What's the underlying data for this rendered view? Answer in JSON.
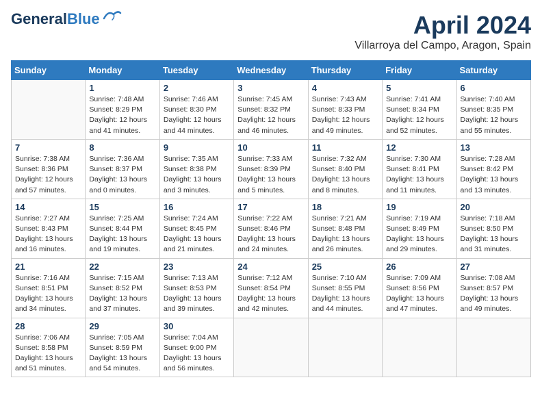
{
  "header": {
    "logo_line1": "General",
    "logo_line2": "Blue",
    "title": "April 2024",
    "subtitle": "Villarroya del Campo, Aragon, Spain"
  },
  "days_of_week": [
    "Sunday",
    "Monday",
    "Tuesday",
    "Wednesday",
    "Thursday",
    "Friday",
    "Saturday"
  ],
  "weeks": [
    [
      {
        "num": "",
        "info": ""
      },
      {
        "num": "1",
        "info": "Sunrise: 7:48 AM\nSunset: 8:29 PM\nDaylight: 12 hours\nand 41 minutes."
      },
      {
        "num": "2",
        "info": "Sunrise: 7:46 AM\nSunset: 8:30 PM\nDaylight: 12 hours\nand 44 minutes."
      },
      {
        "num": "3",
        "info": "Sunrise: 7:45 AM\nSunset: 8:32 PM\nDaylight: 12 hours\nand 46 minutes."
      },
      {
        "num": "4",
        "info": "Sunrise: 7:43 AM\nSunset: 8:33 PM\nDaylight: 12 hours\nand 49 minutes."
      },
      {
        "num": "5",
        "info": "Sunrise: 7:41 AM\nSunset: 8:34 PM\nDaylight: 12 hours\nand 52 minutes."
      },
      {
        "num": "6",
        "info": "Sunrise: 7:40 AM\nSunset: 8:35 PM\nDaylight: 12 hours\nand 55 minutes."
      }
    ],
    [
      {
        "num": "7",
        "info": "Sunrise: 7:38 AM\nSunset: 8:36 PM\nDaylight: 12 hours\nand 57 minutes."
      },
      {
        "num": "8",
        "info": "Sunrise: 7:36 AM\nSunset: 8:37 PM\nDaylight: 13 hours\nand 0 minutes."
      },
      {
        "num": "9",
        "info": "Sunrise: 7:35 AM\nSunset: 8:38 PM\nDaylight: 13 hours\nand 3 minutes."
      },
      {
        "num": "10",
        "info": "Sunrise: 7:33 AM\nSunset: 8:39 PM\nDaylight: 13 hours\nand 5 minutes."
      },
      {
        "num": "11",
        "info": "Sunrise: 7:32 AM\nSunset: 8:40 PM\nDaylight: 13 hours\nand 8 minutes."
      },
      {
        "num": "12",
        "info": "Sunrise: 7:30 AM\nSunset: 8:41 PM\nDaylight: 13 hours\nand 11 minutes."
      },
      {
        "num": "13",
        "info": "Sunrise: 7:28 AM\nSunset: 8:42 PM\nDaylight: 13 hours\nand 13 minutes."
      }
    ],
    [
      {
        "num": "14",
        "info": "Sunrise: 7:27 AM\nSunset: 8:43 PM\nDaylight: 13 hours\nand 16 minutes."
      },
      {
        "num": "15",
        "info": "Sunrise: 7:25 AM\nSunset: 8:44 PM\nDaylight: 13 hours\nand 19 minutes."
      },
      {
        "num": "16",
        "info": "Sunrise: 7:24 AM\nSunset: 8:45 PM\nDaylight: 13 hours\nand 21 minutes."
      },
      {
        "num": "17",
        "info": "Sunrise: 7:22 AM\nSunset: 8:46 PM\nDaylight: 13 hours\nand 24 minutes."
      },
      {
        "num": "18",
        "info": "Sunrise: 7:21 AM\nSunset: 8:48 PM\nDaylight: 13 hours\nand 26 minutes."
      },
      {
        "num": "19",
        "info": "Sunrise: 7:19 AM\nSunset: 8:49 PM\nDaylight: 13 hours\nand 29 minutes."
      },
      {
        "num": "20",
        "info": "Sunrise: 7:18 AM\nSunset: 8:50 PM\nDaylight: 13 hours\nand 31 minutes."
      }
    ],
    [
      {
        "num": "21",
        "info": "Sunrise: 7:16 AM\nSunset: 8:51 PM\nDaylight: 13 hours\nand 34 minutes."
      },
      {
        "num": "22",
        "info": "Sunrise: 7:15 AM\nSunset: 8:52 PM\nDaylight: 13 hours\nand 37 minutes."
      },
      {
        "num": "23",
        "info": "Sunrise: 7:13 AM\nSunset: 8:53 PM\nDaylight: 13 hours\nand 39 minutes."
      },
      {
        "num": "24",
        "info": "Sunrise: 7:12 AM\nSunset: 8:54 PM\nDaylight: 13 hours\nand 42 minutes."
      },
      {
        "num": "25",
        "info": "Sunrise: 7:10 AM\nSunset: 8:55 PM\nDaylight: 13 hours\nand 44 minutes."
      },
      {
        "num": "26",
        "info": "Sunrise: 7:09 AM\nSunset: 8:56 PM\nDaylight: 13 hours\nand 47 minutes."
      },
      {
        "num": "27",
        "info": "Sunrise: 7:08 AM\nSunset: 8:57 PM\nDaylight: 13 hours\nand 49 minutes."
      }
    ],
    [
      {
        "num": "28",
        "info": "Sunrise: 7:06 AM\nSunset: 8:58 PM\nDaylight: 13 hours\nand 51 minutes."
      },
      {
        "num": "29",
        "info": "Sunrise: 7:05 AM\nSunset: 8:59 PM\nDaylight: 13 hours\nand 54 minutes."
      },
      {
        "num": "30",
        "info": "Sunrise: 7:04 AM\nSunset: 9:00 PM\nDaylight: 13 hours\nand 56 minutes."
      },
      {
        "num": "",
        "info": ""
      },
      {
        "num": "",
        "info": ""
      },
      {
        "num": "",
        "info": ""
      },
      {
        "num": "",
        "info": ""
      }
    ]
  ]
}
